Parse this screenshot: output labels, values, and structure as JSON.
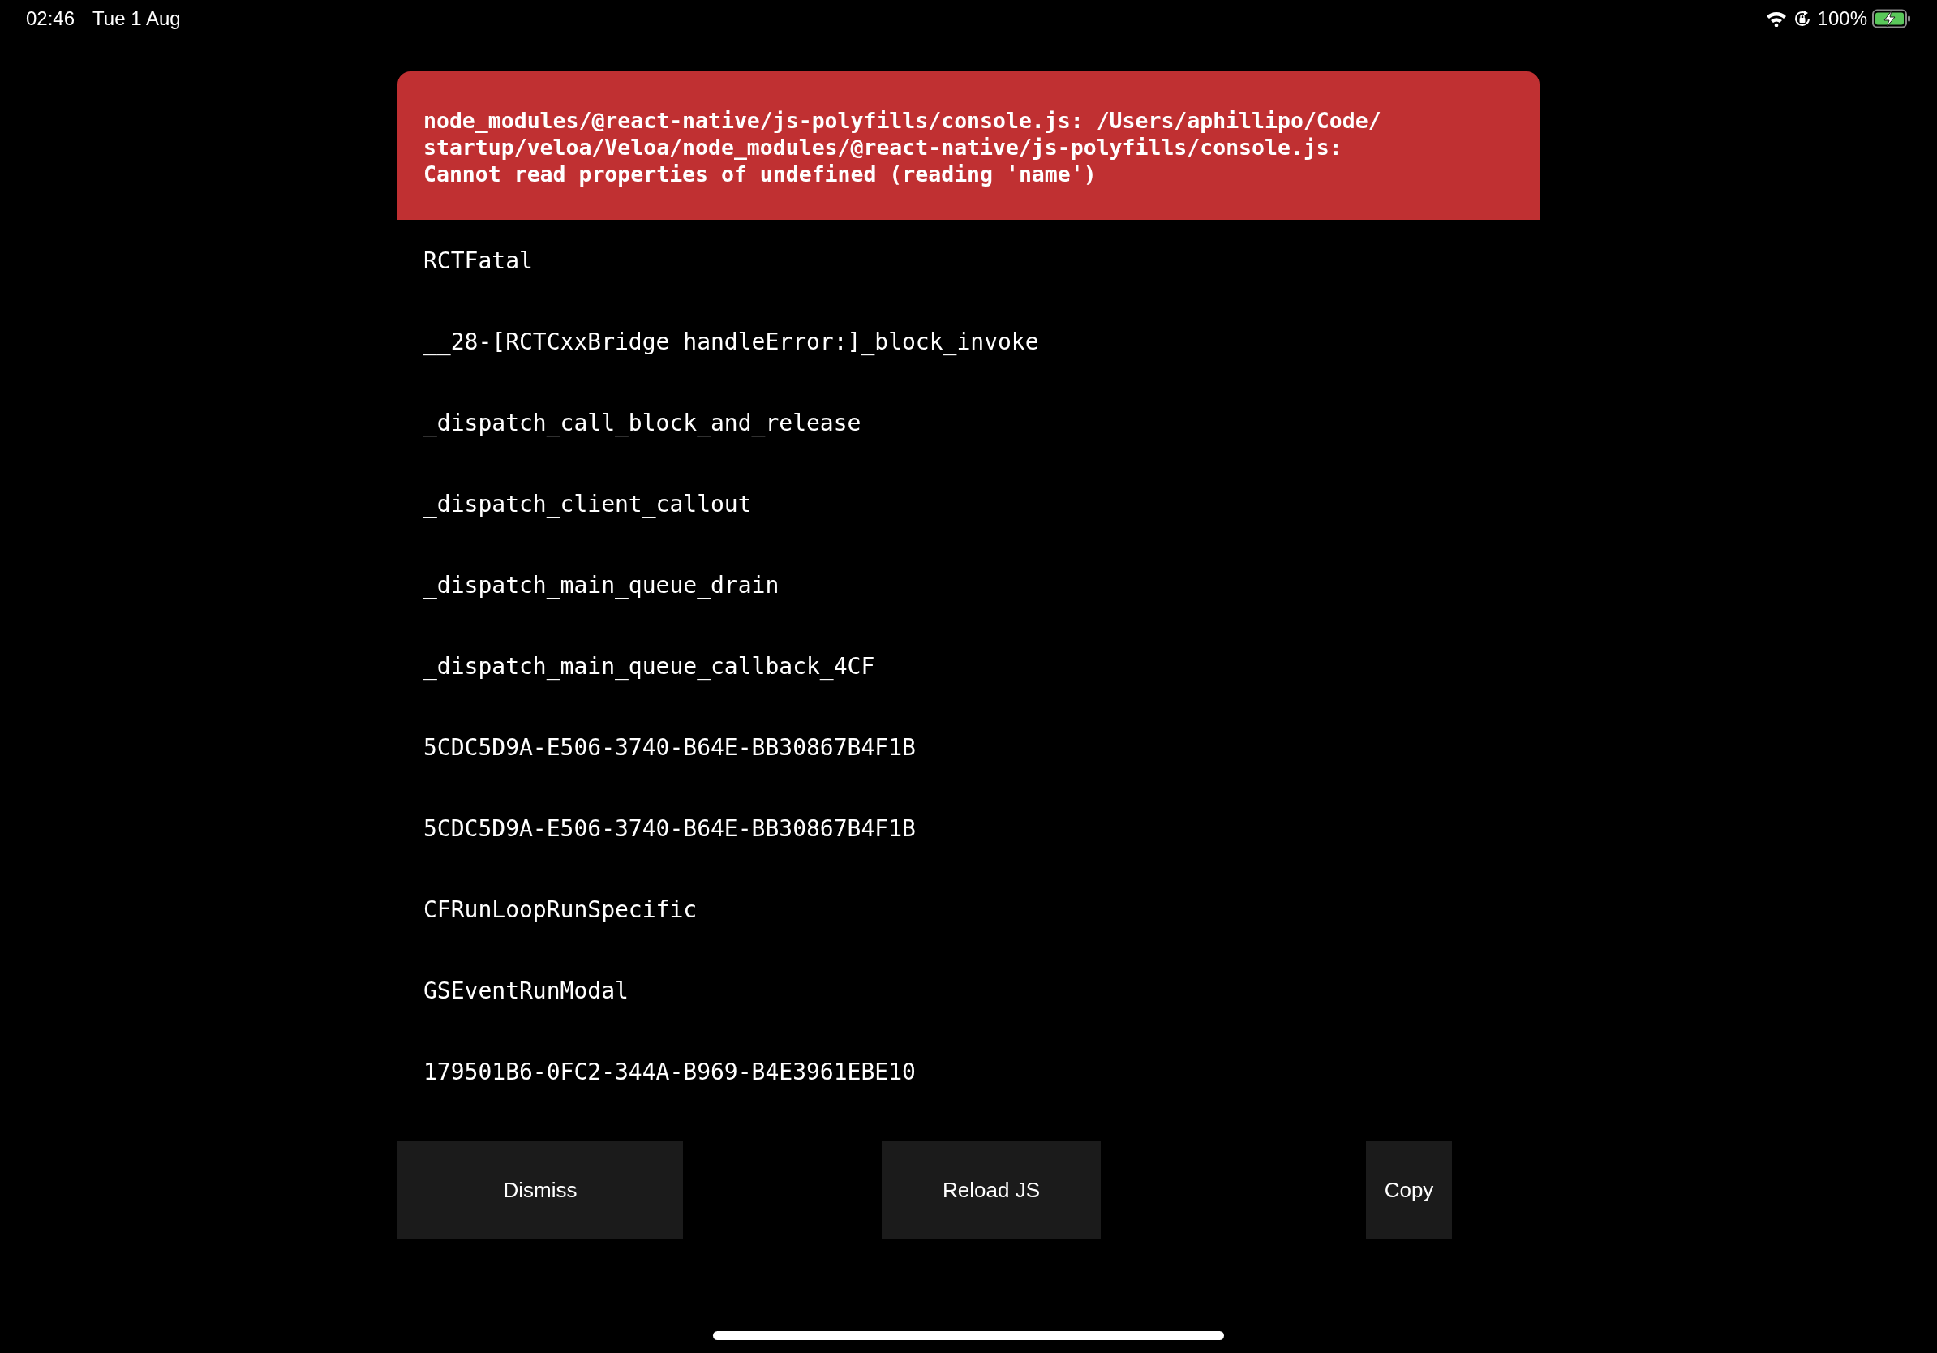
{
  "status_bar": {
    "time": "02:46",
    "date": "Tue 1 Aug",
    "battery": "100%",
    "charging": true
  },
  "error": {
    "message": "node_modules/@react-native/js-polyfills/console.js: /Users/aphillipo/Code/\nstartup/veloa/Veloa/node_modules/@react-native/js-polyfills/console.js:\nCannot read properties of undefined (reading 'name')"
  },
  "stack": [
    "RCTFatal",
    "__28-[RCTCxxBridge handleError:]_block_invoke",
    "_dispatch_call_block_and_release",
    "_dispatch_client_callout",
    "_dispatch_main_queue_drain",
    "_dispatch_main_queue_callback_4CF",
    "5CDC5D9A-E506-3740-B64E-BB30867B4F1B",
    "5CDC5D9A-E506-3740-B64E-BB30867B4F1B",
    "CFRunLoopRunSpecific",
    "GSEventRunModal",
    "179501B6-0FC2-344A-B969-B4E3961EBE10"
  ],
  "buttons": [
    {
      "label": "Dismiss",
      "kind": "dismiss"
    },
    {
      "label": "Reload JS",
      "kind": "reload"
    },
    {
      "label": "Copy",
      "kind": "copy"
    }
  ]
}
